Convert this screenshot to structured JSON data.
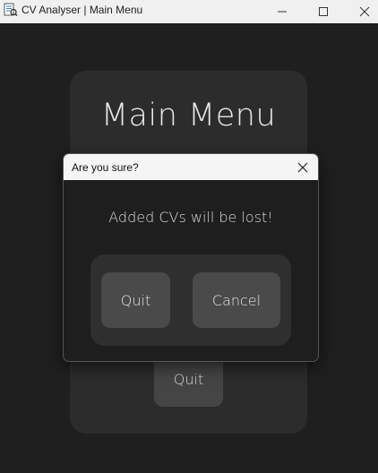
{
  "window": {
    "title": "CV Analyser | Main Menu",
    "icon": "app-icon",
    "controls": [
      "minimize-icon",
      "maximize-icon",
      "close-icon"
    ]
  },
  "main_menu": {
    "title": "Main Menu",
    "quit_label": "Quit"
  },
  "dialog": {
    "title": "Are you sure?",
    "message": "Added CVs will be lost!",
    "quit_label": "Quit",
    "cancel_label": "Cancel"
  },
  "colors": {
    "background": "#1f1f1f",
    "panel": "#2c2c2c",
    "button": "#4a4a4a",
    "text": "#dcdcdc"
  }
}
